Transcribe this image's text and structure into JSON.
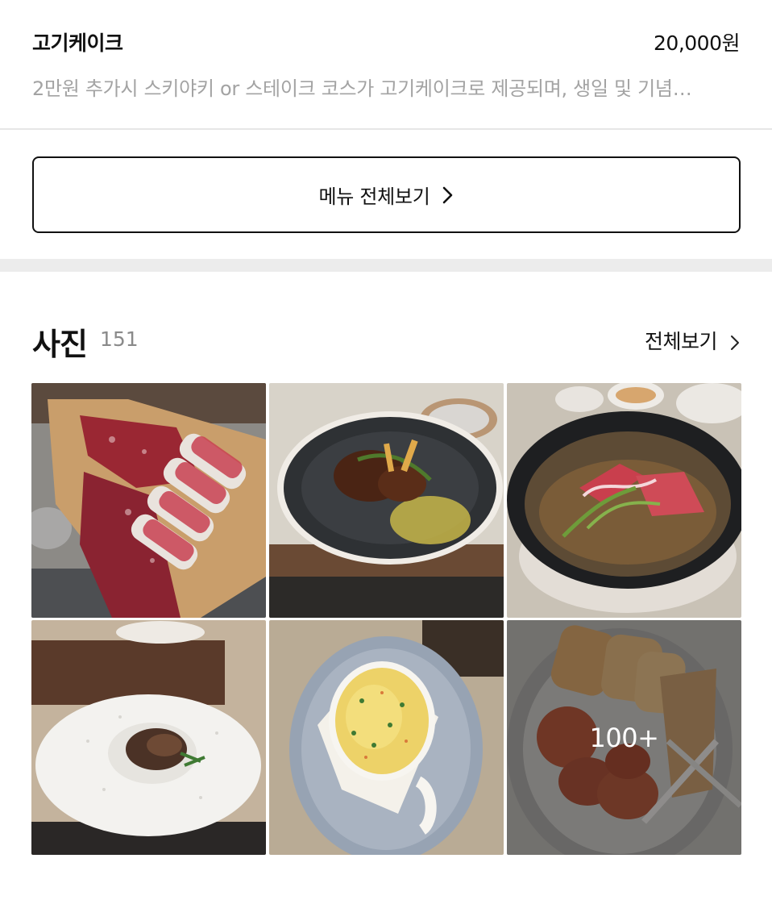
{
  "menu_item": {
    "name": "고기케이크",
    "price": "20,000원",
    "description": "2만원 추가시 스키야키 or 스테이크 코스가 고기케이크로 제공되며, 생일 및 기념…"
  },
  "full_menu_button": {
    "label": "메뉴 전체보기"
  },
  "photos_section": {
    "title": "사진",
    "count": "151",
    "view_all_label": "전체보기",
    "more_overlay": "100+"
  },
  "photos": [
    {
      "subject": "raw-beef-platter"
    },
    {
      "subject": "glazed-meat-dish"
    },
    {
      "subject": "sukiyaki-pot"
    },
    {
      "subject": "steak-plate"
    },
    {
      "subject": "gratin-bowl"
    },
    {
      "subject": "bread-and-patties"
    }
  ]
}
